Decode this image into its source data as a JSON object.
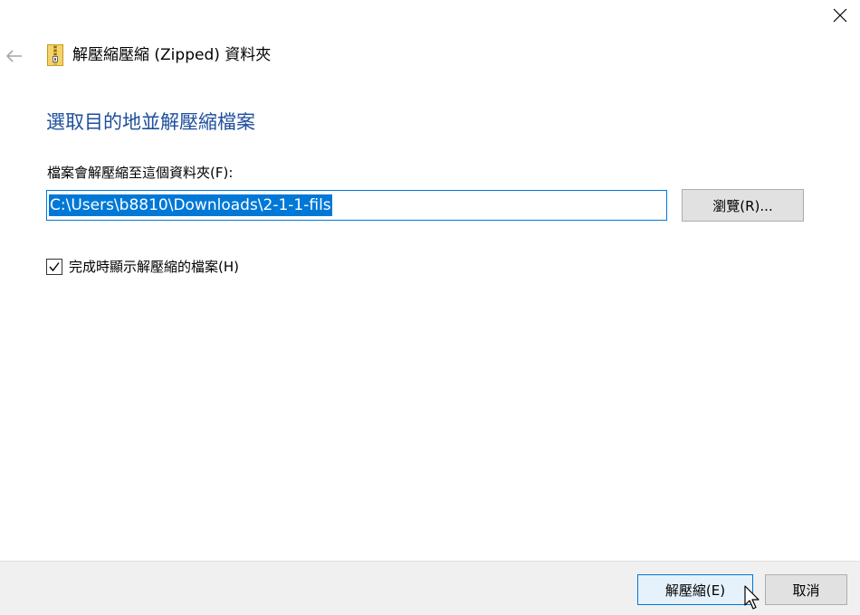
{
  "window": {
    "title": "解壓縮壓縮 (Zipped) 資料夾",
    "close_icon": "close-icon",
    "back_icon": "back-arrow-icon",
    "folder_icon": "zip-folder-icon"
  },
  "main": {
    "heading": "選取目的地並解壓縮檔案",
    "dest_label": "檔案會解壓縮至這個資料夾(F):",
    "path_value": "C:\\Users\\b8810\\Downloads\\2-1-1-fils",
    "browse_label": "瀏覽(R)...",
    "show_files_checked": true,
    "show_files_label": "完成時顯示解壓縮的檔案(H)"
  },
  "footer": {
    "extract_label": "解壓縮(E)",
    "cancel_label": "取消"
  },
  "colors": {
    "heading": "#1e4e9b",
    "accent": "#0078d7",
    "footer_bg": "#f0f0f0",
    "button_bg": "#e1e1e1"
  }
}
